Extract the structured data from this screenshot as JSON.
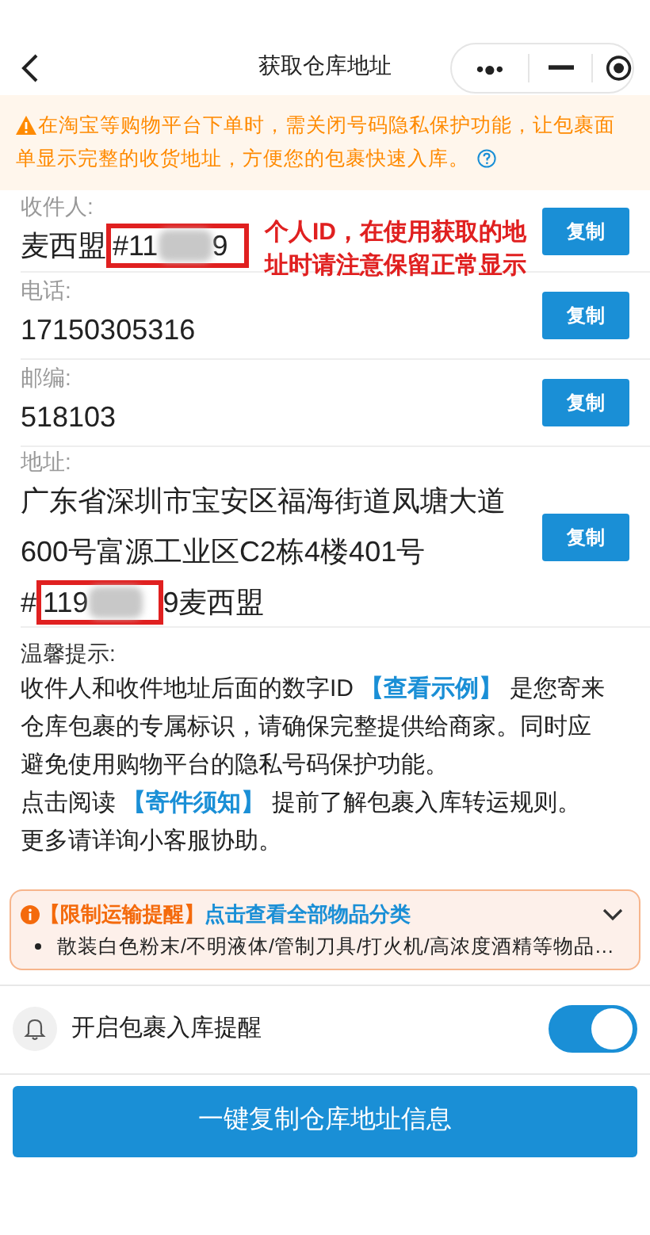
{
  "header": {
    "title": "获取仓库地址",
    "capsule": {
      "more": "•●•"
    }
  },
  "notice": {
    "text": "在淘宝等购物平台下单时，需关闭号码隐私保护功能，让包裹面单显示完整的收货地址，方便您的包裹快速入库。"
  },
  "fields": [
    {
      "label": "收件人:",
      "copy": "复制",
      "lines": [
        [
          {
            "kind": "text",
            "text": "麦西盟"
          },
          {
            "kind": "text",
            "text": "#11",
            "boxed": true
          },
          {
            "kind": "mask",
            "boxed": true
          },
          {
            "kind": "text",
            "text": "9",
            "boxed": true
          }
        ]
      ],
      "annotation": "个人ID，在使用获取的地址时请注意保留正常显示"
    },
    {
      "label": "电话:",
      "copy": "复制",
      "lines": [
        [
          {
            "kind": "text",
            "text": "17150305316"
          }
        ]
      ]
    },
    {
      "label": "邮编:",
      "copy": "复制",
      "lines": [
        [
          {
            "kind": "text",
            "text": "518103"
          }
        ]
      ]
    },
    {
      "label": "地址:",
      "copy": "复制",
      "lines": [
        [
          {
            "kind": "text",
            "text": "广东省深圳市宝安区福海街道凤塘大道"
          }
        ],
        [
          {
            "kind": "text",
            "text": "600号富源工业区C2栋4楼401号"
          }
        ],
        [
          {
            "kind": "text",
            "text": "#"
          },
          {
            "kind": "text",
            "text": "119",
            "boxed": true
          },
          {
            "kind": "mask",
            "boxed": true
          },
          {
            "kind": "text",
            "text": "9麦西盟"
          }
        ]
      ]
    }
  ],
  "tips": {
    "title": "温馨提示:",
    "paragraphs": [
      [
        {
          "kind": "text",
          "text": "收件人和收件地址后面的数字ID "
        },
        {
          "kind": "link",
          "text": "【查看示例】"
        },
        {
          "kind": "text",
          "text": " 是您寄来仓库包裹的专属标识，请确保完整提供给商家。同时应避免使用购物平台的隐私号码保护功能。"
        }
      ],
      [
        {
          "kind": "text",
          "text": "点击阅读 "
        },
        {
          "kind": "link",
          "text": "【寄件须知】"
        },
        {
          "kind": "text",
          "text": " 提前了解包裹入库转运规则。"
        }
      ],
      [
        {
          "kind": "text",
          "text": "更多请详询小客服协助。"
        }
      ]
    ]
  },
  "restriction": {
    "tag": "【限制运输提醒】",
    "link": "点击查看全部物品分类",
    "expanded": false,
    "items": [
      "散装白色粉末/不明液体/管制刀具/打火机/高浓度酒精等物品…"
    ]
  },
  "reminder": {
    "label": "开启包裹入库提醒",
    "on": true
  },
  "primary_button": "一键复制仓库地址信息"
}
